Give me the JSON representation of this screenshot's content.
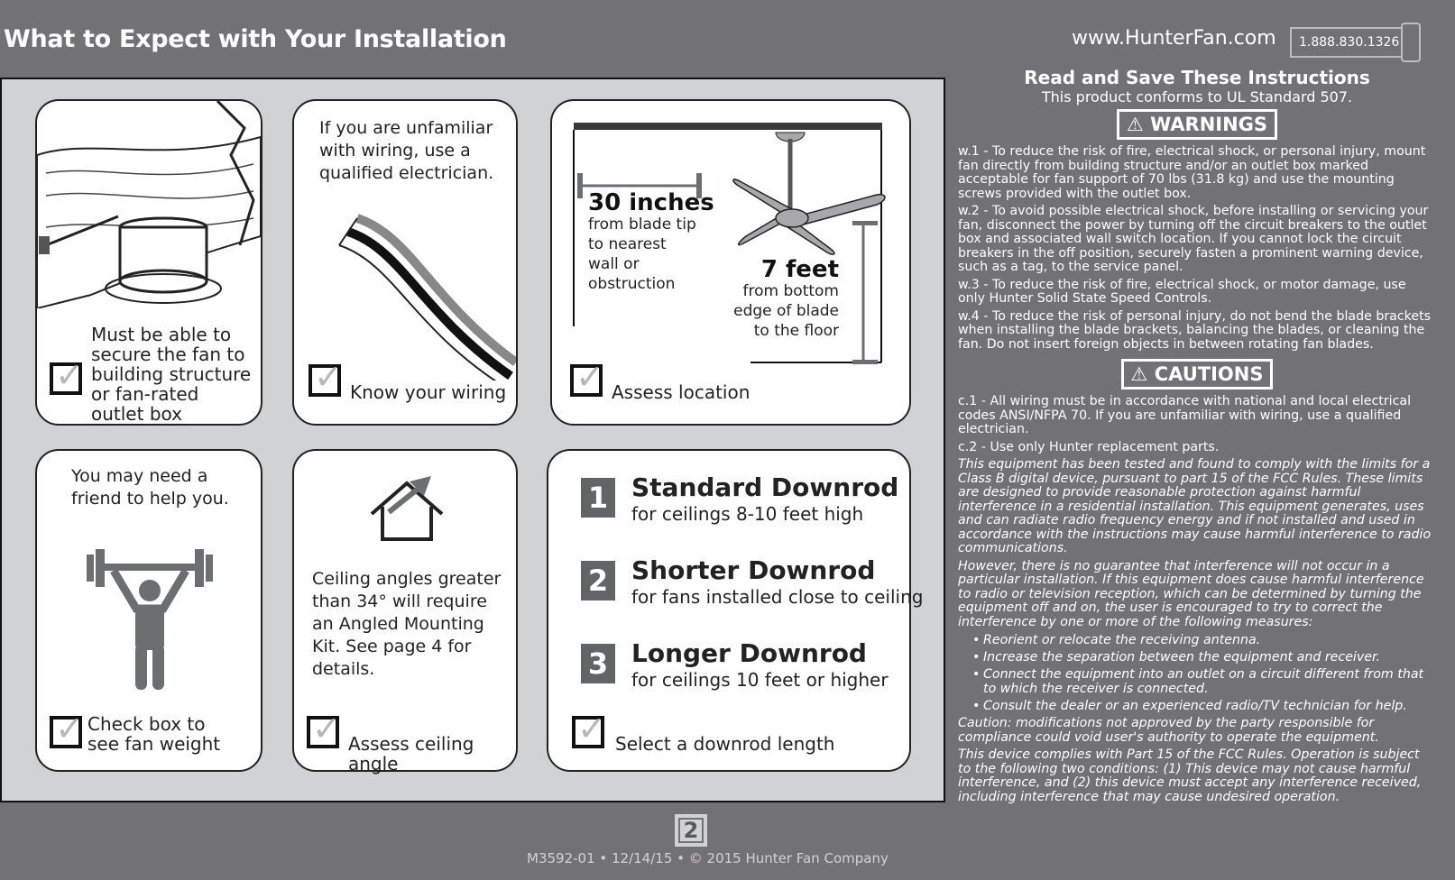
{
  "header": {
    "title": "What to Expect with Your Installation",
    "website": "www.HunterFan.com",
    "phone": "1.888.830.1326"
  },
  "cards": {
    "structure": {
      "text": "Must be able to secure the fan to building structure or fan-rated outlet box",
      "checked": true
    },
    "wiring": {
      "body": "If you are unfamiliar with wiring, use a qualified electrician.",
      "label": "Know your wiring",
      "checked": true
    },
    "location": {
      "dim1_value": "30 inches",
      "dim1_desc": "from blade tip to nearest wall or obstruction",
      "dim2_value": "7 feet",
      "dim2_desc": "from bottom edge of blade to the floor",
      "label": "Assess location",
      "checked": true
    },
    "weight": {
      "body": "You may need a friend to help you.",
      "label": "Check box to see fan weight",
      "checked": true
    },
    "angle": {
      "body": "Ceiling angles greater than 34° will require an Angled Mounting Kit. See page 4 for details.",
      "label": "Assess ceiling angle",
      "checked": true
    },
    "downrod": {
      "steps": [
        {
          "num": "1",
          "title": "Standard Downrod",
          "desc": "for ceilings 8-10 feet high"
        },
        {
          "num": "2",
          "title": "Shorter Downrod",
          "desc": "for fans installed close to ceiling"
        },
        {
          "num": "3",
          "title": "Longer Downrod",
          "desc": "for ceilings 10 feet or higher"
        }
      ],
      "label": "Select a downrod length",
      "checked": true
    }
  },
  "right": {
    "heading": "Read and Save These Instructions",
    "subheading": "This product conforms to UL Standard 507.",
    "warnings_label": "WARNINGS",
    "warnings": [
      "w.1 - To reduce the risk of fire, electrical shock, or personal injury, mount fan directly from building structure and/or an outlet box marked acceptable for fan support of 70 lbs (31.8 kg) and use the mounting screws provided with the outlet box.",
      "w.2 - To avoid possible electrical shock, before installing or servicing your fan, disconnect the power by turning off the circuit breakers to the outlet box and associated wall switch location. If you cannot lock the circuit breakers in the off position, securely fasten a prominent warning device, such as a tag, to the service panel.",
      "w.3 - To reduce the risk of fire, electrical shock, or motor damage, use only Hunter Solid State Speed Controls.",
      "w.4 - To reduce the risk of personal injury, do not bend the blade brackets when installing the blade brackets, balancing the blades, or cleaning the fan. Do not insert foreign objects in between rotating fan blades."
    ],
    "cautions_label": "CAUTIONS",
    "cautions": [
      "c.1 - All wiring must be in accordance with national and local electrical codes ANSI/NFPA 70. If you are unfamiliar with wiring, use a qualified electrician.",
      "c.2 - Use only Hunter replacement parts."
    ],
    "fcc": [
      "This equipment has been tested and found to comply with the limits for a Class B digital device, pursuant to part 15 of the FCC Rules. These limits are designed to provide reasonable protection against harmful interference in a residential installation. This equipment generates, uses and can radiate radio frequency energy and if not installed and used in accordance with the instructions may cause harmful interference to radio communications.",
      "However, there is no guarantee that interference will not occur in a particular installation. If this equipment does cause harmful interference to radio or television reception, which can be determined by turning the equipment off and on, the user is encouraged to try to correct the interference by one or more of the following measures:"
    ],
    "measures": [
      "Reorient or relocate the receiving antenna.",
      "Increase the separation between the equipment and receiver.",
      "Connect the equipment into an outlet on a circuit different from that to which the receiver is connected.",
      "Consult the dealer or an experienced radio/TV technician for help."
    ],
    "fcc_after": [
      "Caution: modifications not approved by the party responsible for compliance could void user's authority to operate the equipment.",
      "This device complies with Part 15 of the FCC Rules.  Operation is subject to the following two conditions: (1) This device may not cause harmful interference, and (2) this device must accept any interference received, including interference that may cause undesired operation."
    ]
  },
  "footer": {
    "page_number": "2",
    "text": "M3592-01 • 12/14/15 • © 2015 Hunter Fan Company"
  }
}
